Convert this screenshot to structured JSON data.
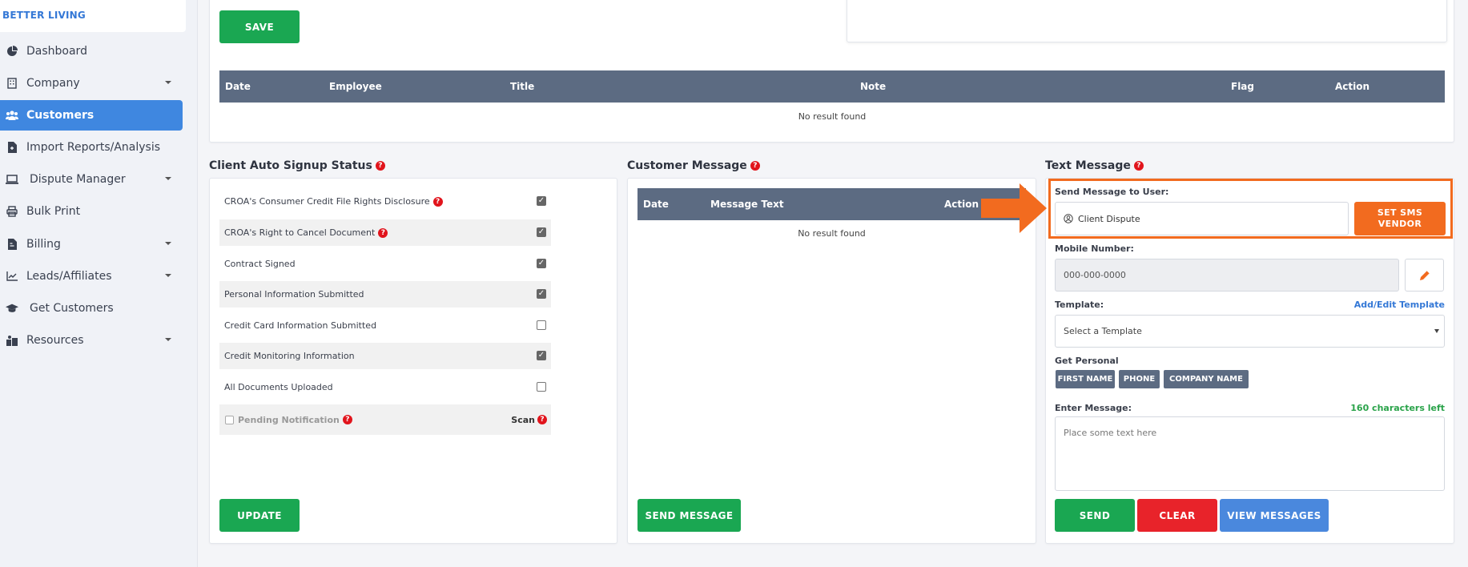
{
  "brand": "BETTER LIVING",
  "sidebar": {
    "items": [
      {
        "label": "Dashboard",
        "icon": "dashboard-icon",
        "caret": false,
        "active": false
      },
      {
        "label": "Company",
        "icon": "building-icon",
        "caret": true,
        "active": false
      },
      {
        "label": "Customers",
        "icon": "users-icon",
        "caret": false,
        "active": true
      },
      {
        "label": "Import Reports/Analysis",
        "icon": "file-import-icon",
        "caret": false,
        "active": false
      },
      {
        "label": "Dispute Manager",
        "icon": "laptop-icon",
        "caret": true,
        "active": false
      },
      {
        "label": "Bulk Print",
        "icon": "printer-icon",
        "caret": false,
        "active": false
      },
      {
        "label": "Billing",
        "icon": "invoice-icon",
        "caret": true,
        "active": false
      },
      {
        "label": "Leads/Affiliates",
        "icon": "chart-line-icon",
        "caret": true,
        "active": false
      },
      {
        "label": "Get Customers",
        "icon": "graduation-cap-icon",
        "caret": false,
        "active": false
      },
      {
        "label": "Resources",
        "icon": "box-icon",
        "caret": true,
        "active": false
      }
    ]
  },
  "notes": {
    "save_label": "SAVE",
    "columns": [
      "Date",
      "Employee",
      "Title",
      "Note",
      "Flag",
      "Action"
    ],
    "empty_text": "No result found"
  },
  "signup": {
    "title": "Client Auto Signup Status",
    "items": [
      {
        "label": "CROA's Consumer Credit File Rights Disclosure",
        "help": true,
        "checked": true
      },
      {
        "label": "CROA's Right to Cancel Document",
        "help": true,
        "checked": true
      },
      {
        "label": "Contract Signed",
        "help": false,
        "checked": true
      },
      {
        "label": "Personal Information Submitted",
        "help": false,
        "checked": true
      },
      {
        "label": "Credit Card Information Submitted",
        "help": false,
        "checked": false
      },
      {
        "label": "Credit Monitoring Information",
        "help": false,
        "checked": true
      },
      {
        "label": "All Documents Uploaded",
        "help": false,
        "checked": false
      }
    ],
    "pending_label": "Pending Notification",
    "scan_label": "Scan",
    "update_label": "UPDATE"
  },
  "customer_message": {
    "title": "Customer Message",
    "columns": [
      "Date",
      "Message Text",
      "Action"
    ],
    "empty_text": "No result found",
    "send_label": "SEND MESSAGE"
  },
  "text_message": {
    "title": "Text Message",
    "send_to_label": "Send Message to User:",
    "send_to_value": "Client Dispute",
    "sms_vendor_label": "SET SMS VENDOR",
    "mobile_label": "Mobile Number:",
    "mobile_placeholder": "000-000-0000",
    "template_label": "Template:",
    "template_link": "Add/Edit Template",
    "template_selected": "Select a Template",
    "personal_label": "Get Personal",
    "personal_tags": [
      "FIRST NAME",
      "PHONE",
      "COMPANY NAME"
    ],
    "enter_label": "Enter Message:",
    "chars_left": "160 characters left",
    "message_placeholder": "Place some text here",
    "send_label": "SEND",
    "clear_label": "CLEAR",
    "view_label": "VIEW MESSAGES"
  },
  "colors": {
    "accent_blue": "#3f87e0",
    "green": "#1aa752",
    "red": "#e8232a",
    "orange": "#f26b1f",
    "table_header": "#5c6b82"
  }
}
